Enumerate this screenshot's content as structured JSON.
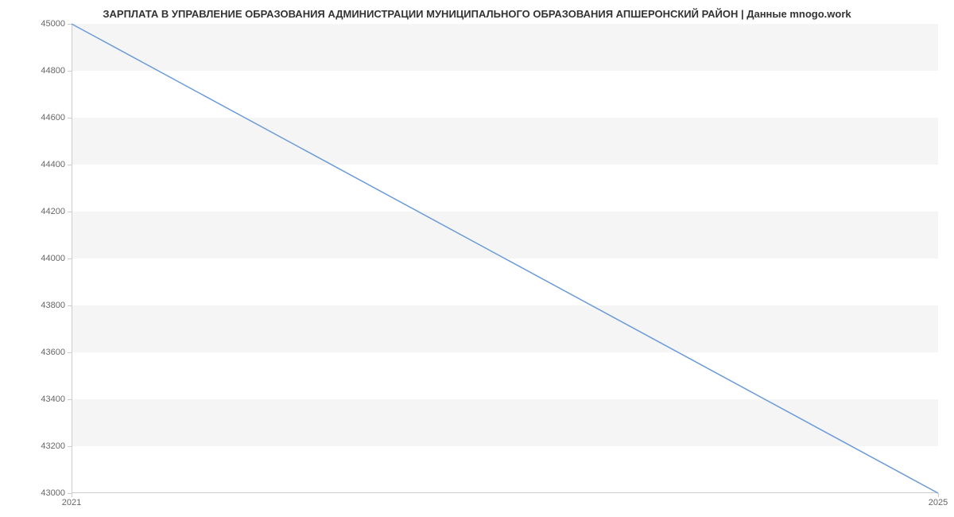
{
  "chart_data": {
    "type": "line",
    "title": "ЗАРПЛАТА В УПРАВЛЕНИЕ ОБРАЗОВАНИЯ АДМИНИСТРАЦИИ МУНИЦИПАЛЬНОГО ОБРАЗОВАНИЯ АПШЕРОНСКИЙ РАЙОН | Данные mnogo.work",
    "x": [
      2021,
      2025
    ],
    "values": [
      45000,
      43000
    ],
    "xlabel": "",
    "ylabel": "",
    "xlim": [
      2021,
      2025
    ],
    "ylim": [
      43000,
      45000
    ],
    "y_ticks": [
      43000,
      43200,
      43400,
      43600,
      43800,
      44000,
      44200,
      44400,
      44600,
      44800,
      45000
    ],
    "x_ticks": [
      2021,
      2025
    ],
    "line_color": "#6b9bd8"
  }
}
